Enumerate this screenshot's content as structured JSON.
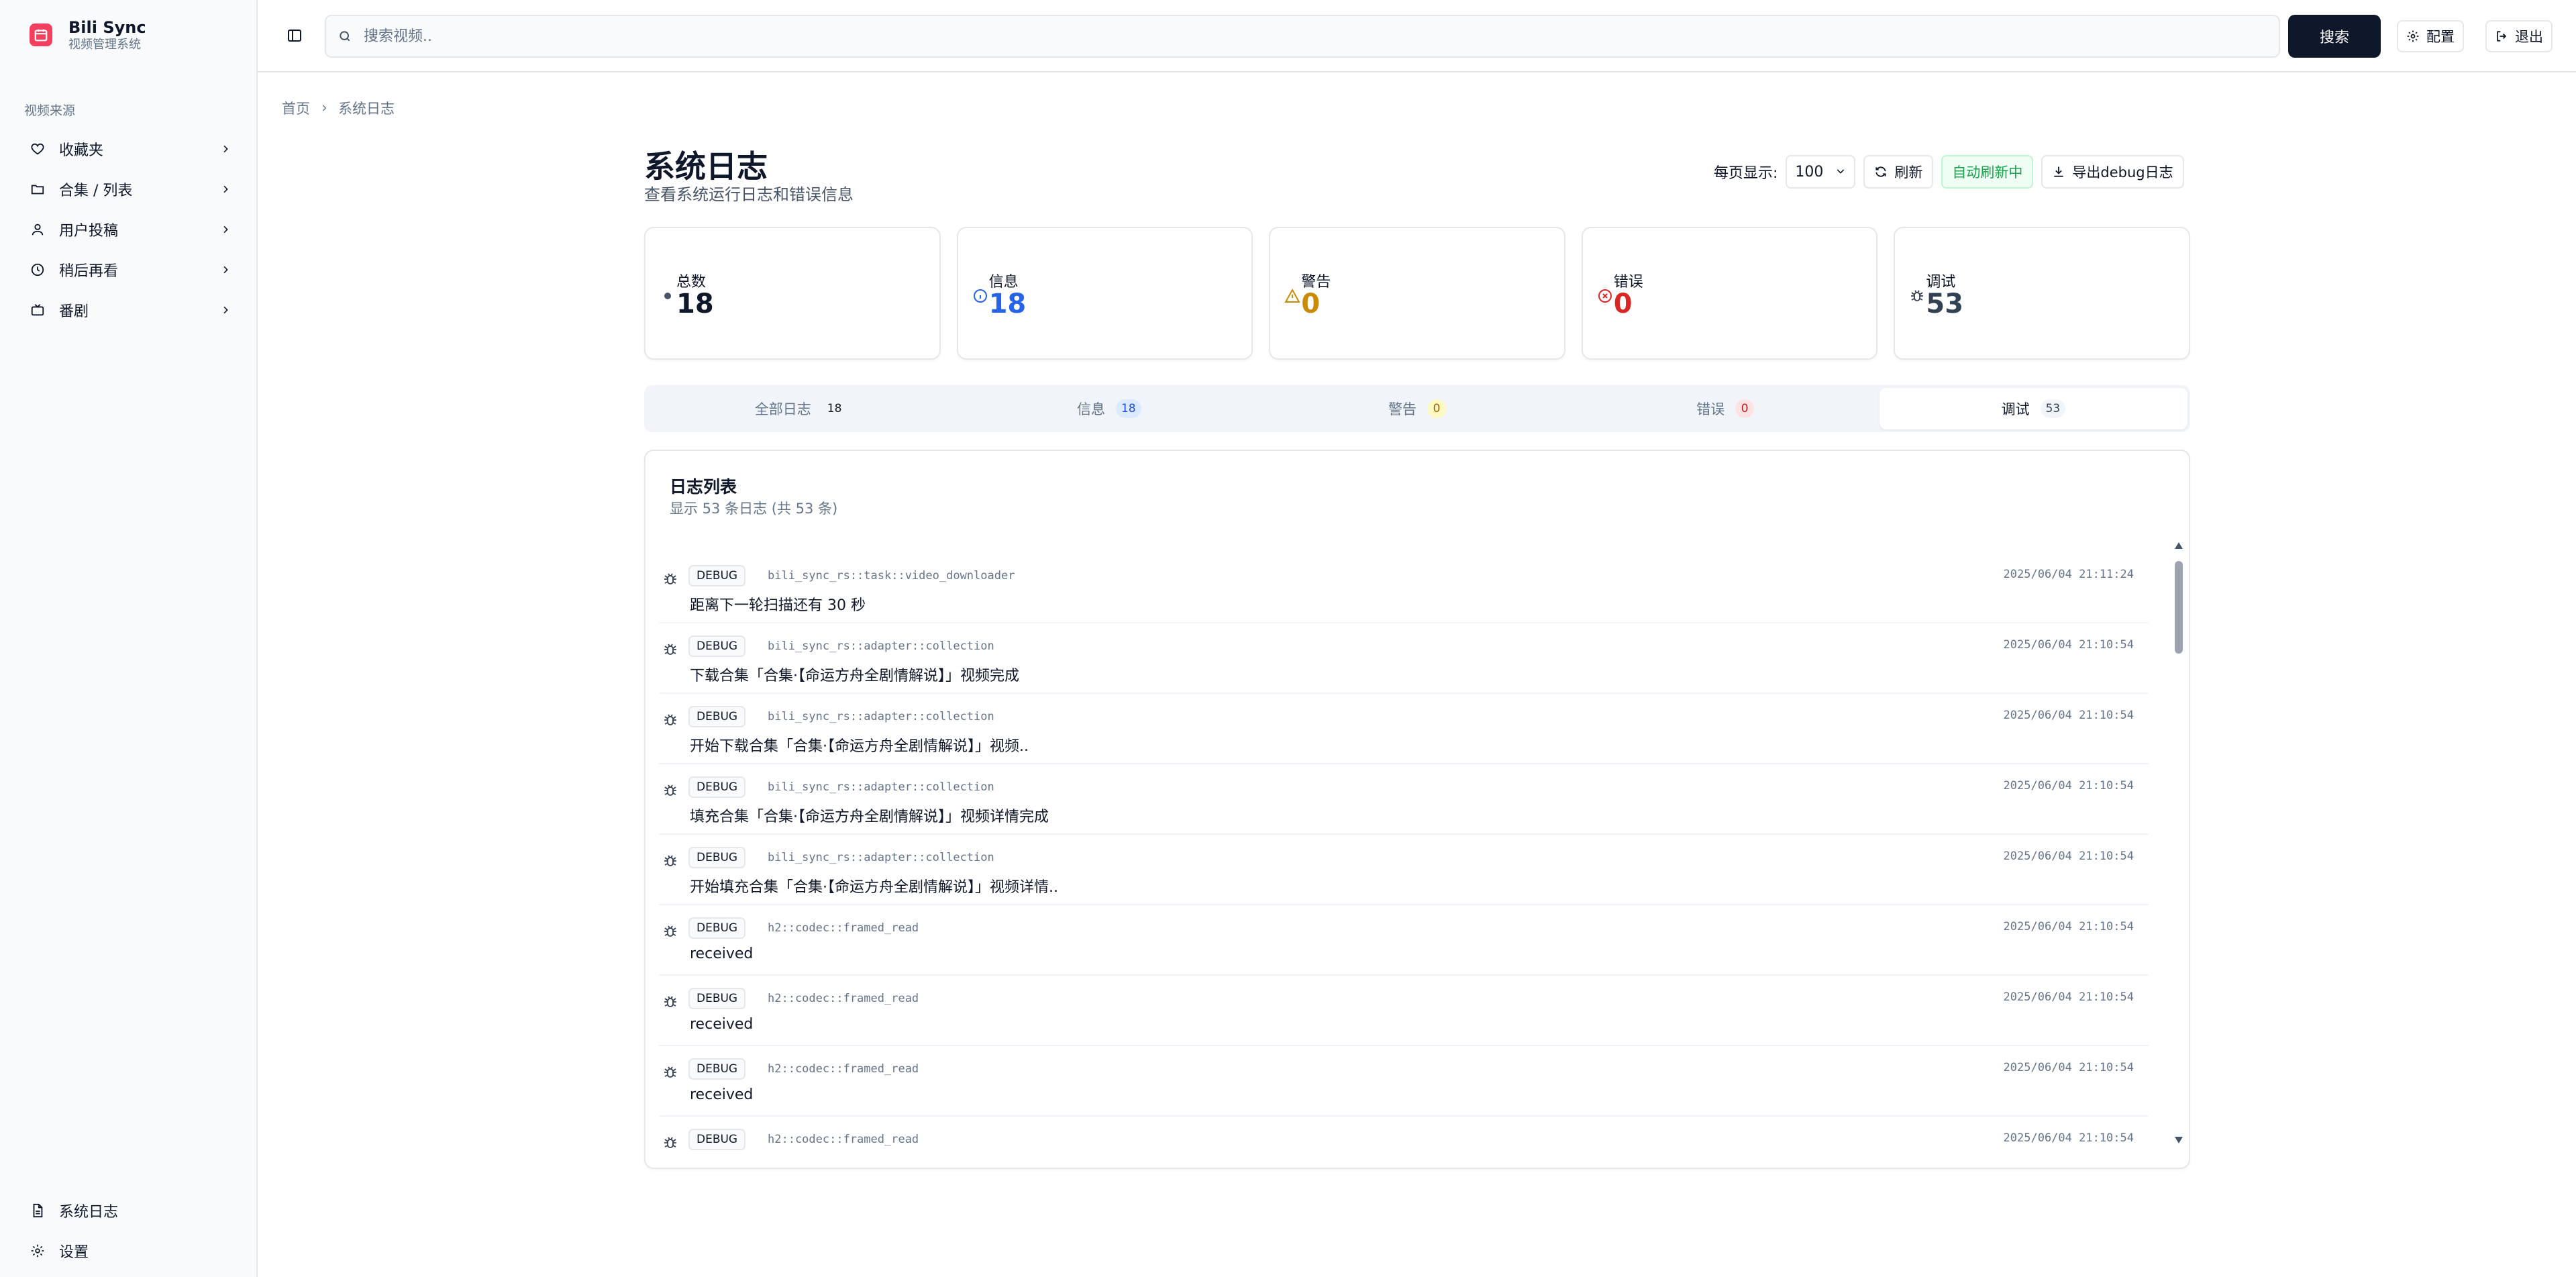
{
  "brand": {
    "title": "Bili Sync",
    "subtitle": "视频管理系统"
  },
  "sidebar": {
    "group_label": "视频来源",
    "items": [
      {
        "label": "收藏夹",
        "icon": "heart-icon"
      },
      {
        "label": "合集 / 列表",
        "icon": "folder-icon"
      },
      {
        "label": "用户投稿",
        "icon": "user-icon"
      },
      {
        "label": "稍后再看",
        "icon": "clock-icon"
      },
      {
        "label": "番剧",
        "icon": "tv-icon"
      }
    ],
    "bottom": [
      {
        "label": "系统日志",
        "icon": "file-text-icon"
      },
      {
        "label": "设置",
        "icon": "gear-icon"
      }
    ]
  },
  "topbar": {
    "search_placeholder": "搜索视频..",
    "search_button": "搜索",
    "config_button": "配置",
    "logout_button": "退出"
  },
  "breadcrumb": {
    "home": "首页",
    "current": "系统日志"
  },
  "page": {
    "title": "系统日志",
    "subtitle": "查看系统运行日志和错误信息"
  },
  "controls": {
    "per_page_label": "每页显示:",
    "per_page_value": "100",
    "refresh": "刷新",
    "auto_refresh": "自动刷新中",
    "export": "导出debug日志"
  },
  "stats": [
    {
      "label": "总数",
      "value": "18",
      "color": "#0f172a",
      "icon": "dot-icon"
    },
    {
      "label": "信息",
      "value": "18",
      "color": "#2563eb",
      "icon": "info-icon"
    },
    {
      "label": "警告",
      "value": "0",
      "color": "#ca8a04",
      "icon": "warning-icon"
    },
    {
      "label": "错误",
      "value": "0",
      "color": "#dc2626",
      "icon": "error-icon"
    },
    {
      "label": "调试",
      "value": "53",
      "color": "#334155",
      "icon": "bug-icon"
    }
  ],
  "tabs": [
    {
      "label": "全部日志",
      "count": "18",
      "badge_bg": "transparent",
      "badge_color": "#0f172a"
    },
    {
      "label": "信息",
      "count": "18",
      "badge_bg": "#dbeafe",
      "badge_color": "#1d4ed8"
    },
    {
      "label": "警告",
      "count": "0",
      "badge_bg": "#fef9c3",
      "badge_color": "#a16207"
    },
    {
      "label": "错误",
      "count": "0",
      "badge_bg": "#fee2e2",
      "badge_color": "#b91c1c"
    },
    {
      "label": "调试",
      "count": "53",
      "badge_bg": "#f1f5f9",
      "badge_color": "#334155"
    }
  ],
  "active_tab": 4,
  "log_card": {
    "title": "日志列表",
    "subtitle": "显示 53 条日志 (共 53 条)"
  },
  "logs": [
    {
      "level": "DEBUG",
      "target": "bili_sync_rs::task::video_downloader",
      "time": "2025/06/04 21:11:24",
      "message": "距离下一轮扫描还有 30 秒"
    },
    {
      "level": "DEBUG",
      "target": "bili_sync_rs::adapter::collection",
      "time": "2025/06/04 21:10:54",
      "message": "下载合集「合集·【命运方舟全剧情解说】」视频完成"
    },
    {
      "level": "DEBUG",
      "target": "bili_sync_rs::adapter::collection",
      "time": "2025/06/04 21:10:54",
      "message": "开始下载合集「合集·【命运方舟全剧情解说】」视频.."
    },
    {
      "level": "DEBUG",
      "target": "bili_sync_rs::adapter::collection",
      "time": "2025/06/04 21:10:54",
      "message": "填充合集「合集·【命运方舟全剧情解说】」视频详情完成"
    },
    {
      "level": "DEBUG",
      "target": "bili_sync_rs::adapter::collection",
      "time": "2025/06/04 21:10:54",
      "message": "开始填充合集「合集·【命运方舟全剧情解说】」视频详情.."
    },
    {
      "level": "DEBUG",
      "target": "h2::codec::framed_read",
      "time": "2025/06/04 21:10:54",
      "message": "received"
    },
    {
      "level": "DEBUG",
      "target": "h2::codec::framed_read",
      "time": "2025/06/04 21:10:54",
      "message": "received"
    },
    {
      "level": "DEBUG",
      "target": "h2::codec::framed_read",
      "time": "2025/06/04 21:10:54",
      "message": "received"
    },
    {
      "level": "DEBUG",
      "target": "h2::codec::framed_read",
      "time": "2025/06/04 21:10:54",
      "message": ""
    }
  ]
}
